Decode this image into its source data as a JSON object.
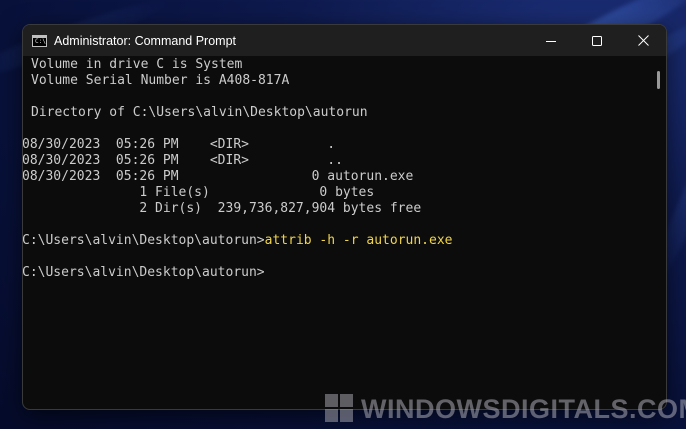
{
  "window": {
    "title": "Administrator: Command Prompt",
    "icon": "cmd-icon",
    "controls": [
      "minimize-icon",
      "maximize-icon",
      "close-icon"
    ]
  },
  "console": {
    "lines": [
      "Volume in drive C is System",
      "Volume Serial Number is A408-817A",
      "Directory of C:\\Users\\alvin\\Desktop\\autorun",
      "08/30/2023  05:26 PM    <DIR>          .",
      "08/30/2023  05:26 PM    <DIR>          ..",
      "08/30/2023  05:26 PM                 0 autorun.exe",
      "               1 File(s)              0 bytes",
      "               2 Dir(s)  239,736,827,904 bytes free"
    ],
    "prompt1": "C:\\Users\\alvin\\Desktop\\autorun>",
    "command1": "attrib -h -r autorun.exe",
    "prompt2": "C:\\Users\\alvin\\Desktop\\autorun>"
  },
  "colors": {
    "console_bg": "#0c0c0c",
    "console_text": "#cccccc",
    "command_highlight": "#f0d44a"
  },
  "watermark": {
    "text": "WINDOWSDIGITALS.COM"
  }
}
